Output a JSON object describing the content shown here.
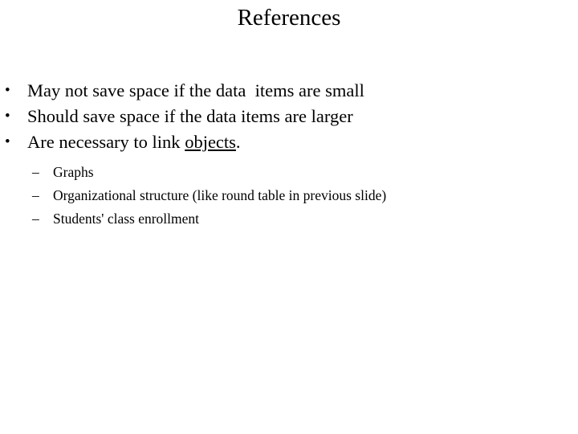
{
  "slide": {
    "title": "References",
    "bullets": [
      {
        "marker": "•",
        "text": "May not save space if the data  items are small"
      },
      {
        "marker": "•",
        "text": "Should save space if the data items are larger"
      },
      {
        "marker": "•",
        "text_before": "Are necessary to link ",
        "link_text": "objects",
        "text_after": "."
      }
    ],
    "sub_bullets": [
      {
        "marker": "–",
        "text": "Graphs"
      },
      {
        "marker": "–",
        "text": "Organizational structure (like round table in previous slide)"
      },
      {
        "marker": "–",
        "text": "Students' class enrollment"
      }
    ]
  }
}
